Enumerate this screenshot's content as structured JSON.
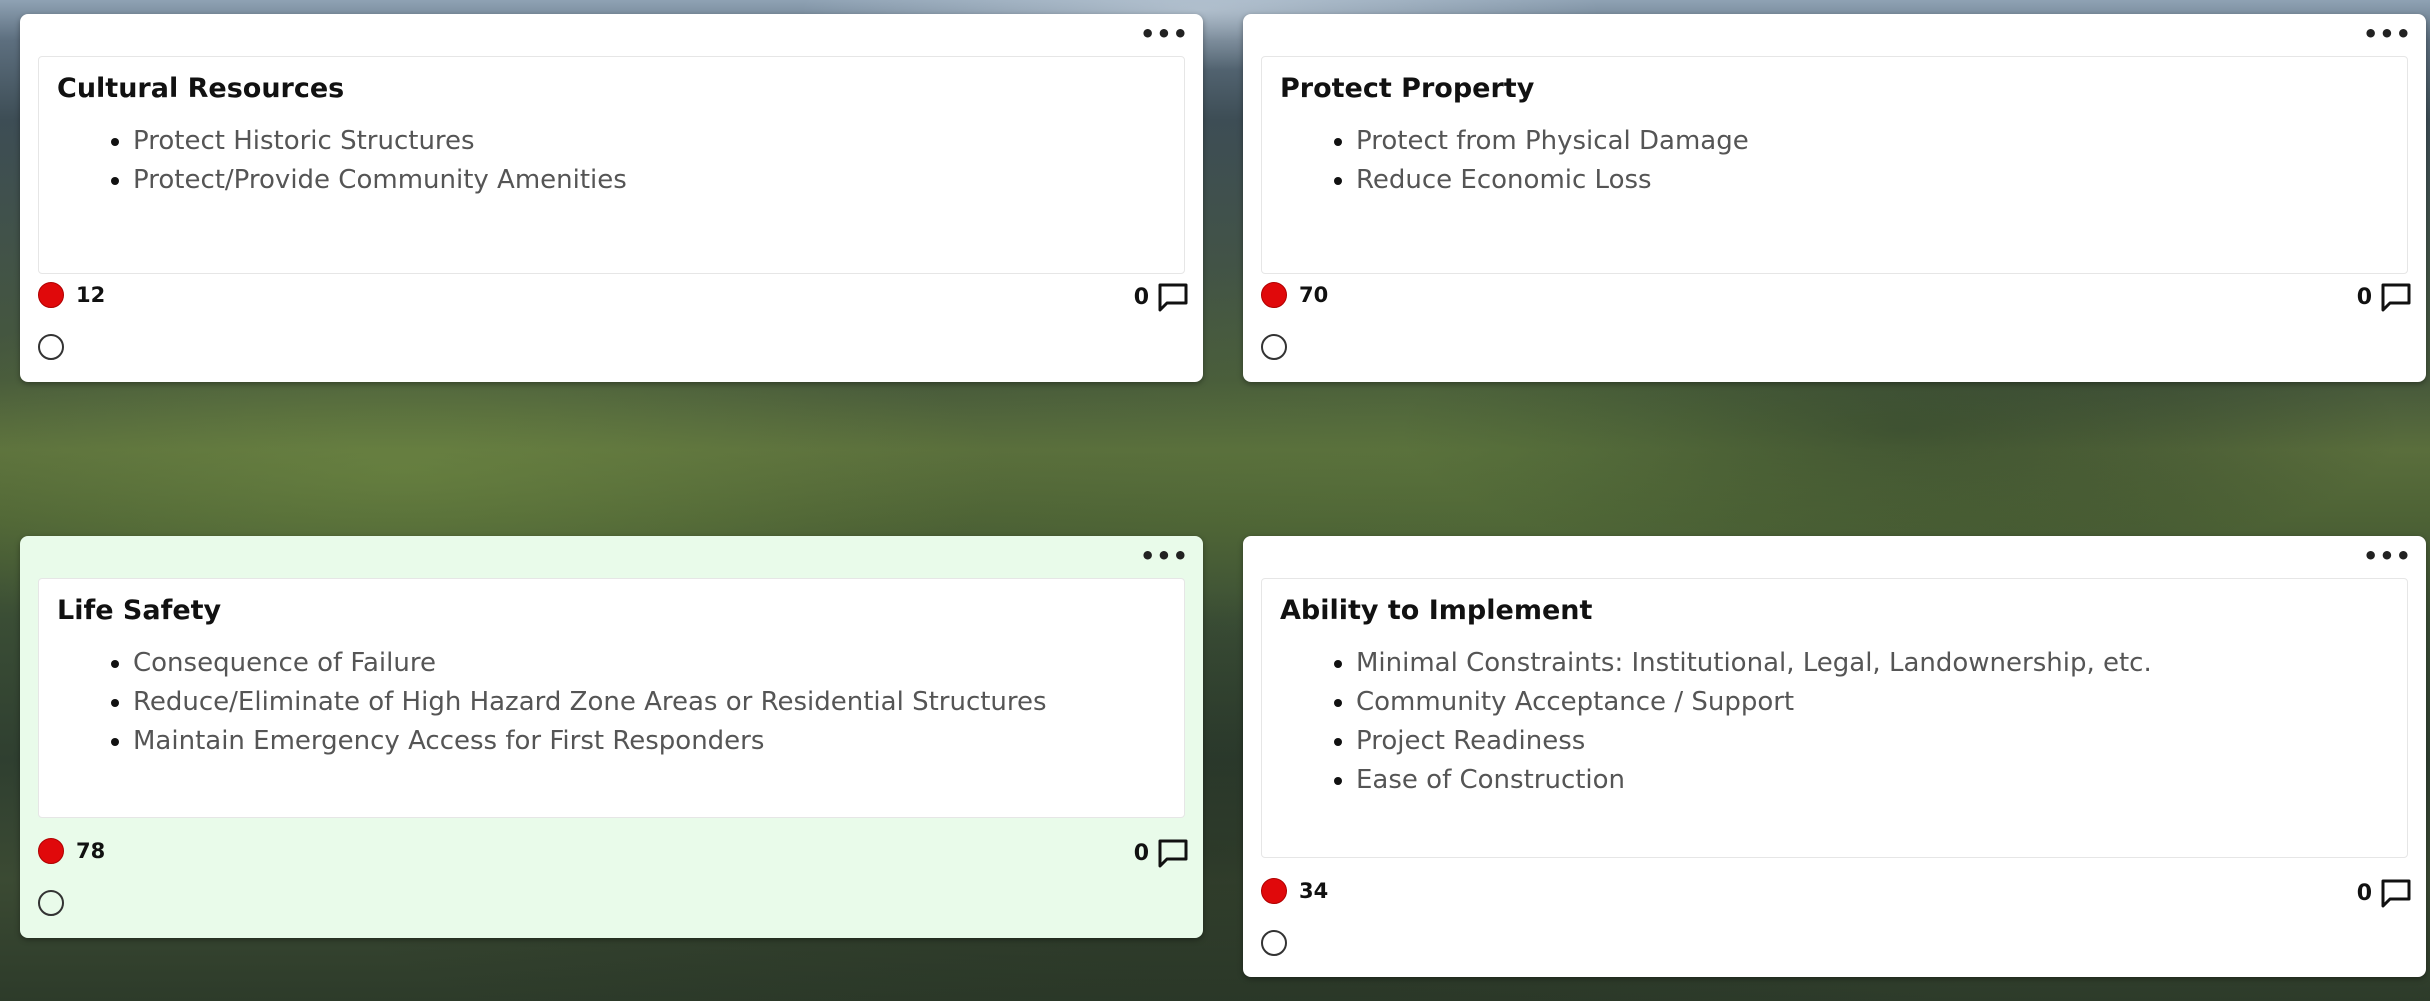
{
  "cards": [
    {
      "title": "Cultural Resources",
      "items": [
        "Protect Historic Structures",
        "Protect/Provide Community Amenities"
      ],
      "votes": "12",
      "comments": "0",
      "menu": "•••"
    },
    {
      "title": "Protect Property",
      "items": [
        "Protect from Physical Damage",
        "Reduce Economic Loss"
      ],
      "votes": "70",
      "comments": "0",
      "menu": "•••"
    },
    {
      "title": "Life Safety",
      "items": [
        "Consequence of Failure",
        "Reduce/Eliminate of High Hazard Zone Areas or Residential Structures",
        "Maintain Emergency Access for First Responders"
      ],
      "votes": "78",
      "comments": "0",
      "menu": "•••"
    },
    {
      "title": "Ability to Implement",
      "items": [
        "Minimal Constraints: Institutional, Legal, Landownership, etc.",
        "Community Acceptance / Support",
        "Project Readiness",
        "Ease of Construction"
      ],
      "votes": "34",
      "comments": "0",
      "menu": "•••"
    }
  ],
  "colors": {
    "vote_dot": "#e0090b",
    "highlight_card": "#e9fbea"
  }
}
